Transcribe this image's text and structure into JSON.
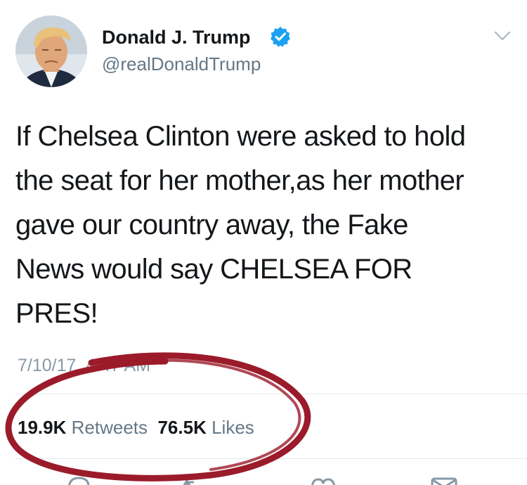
{
  "user": {
    "display_name": "Donald J. Trump",
    "handle": "@realDonaldTrump",
    "verified": true,
    "verified_color": "#1da1f2"
  },
  "tweet": {
    "text": "If Chelsea Clinton were asked to hold\nthe seat for her mother,as her mother\ngave our country away, the Fake\nNews would say CHELSEA FOR\nPRES!",
    "timestamp": "7/10/17, 4:47 AM"
  },
  "stats": {
    "retweets_count": "19.9K",
    "retweets_label": "Retweets",
    "likes_count": "76.5K",
    "likes_label": "Likes"
  },
  "actions": [
    "reply-icon",
    "retweet-icon",
    "like-icon",
    "message-icon"
  ],
  "annotation": {
    "shape": "hand-drawn oval around stats",
    "color": "#9b1b2a"
  }
}
